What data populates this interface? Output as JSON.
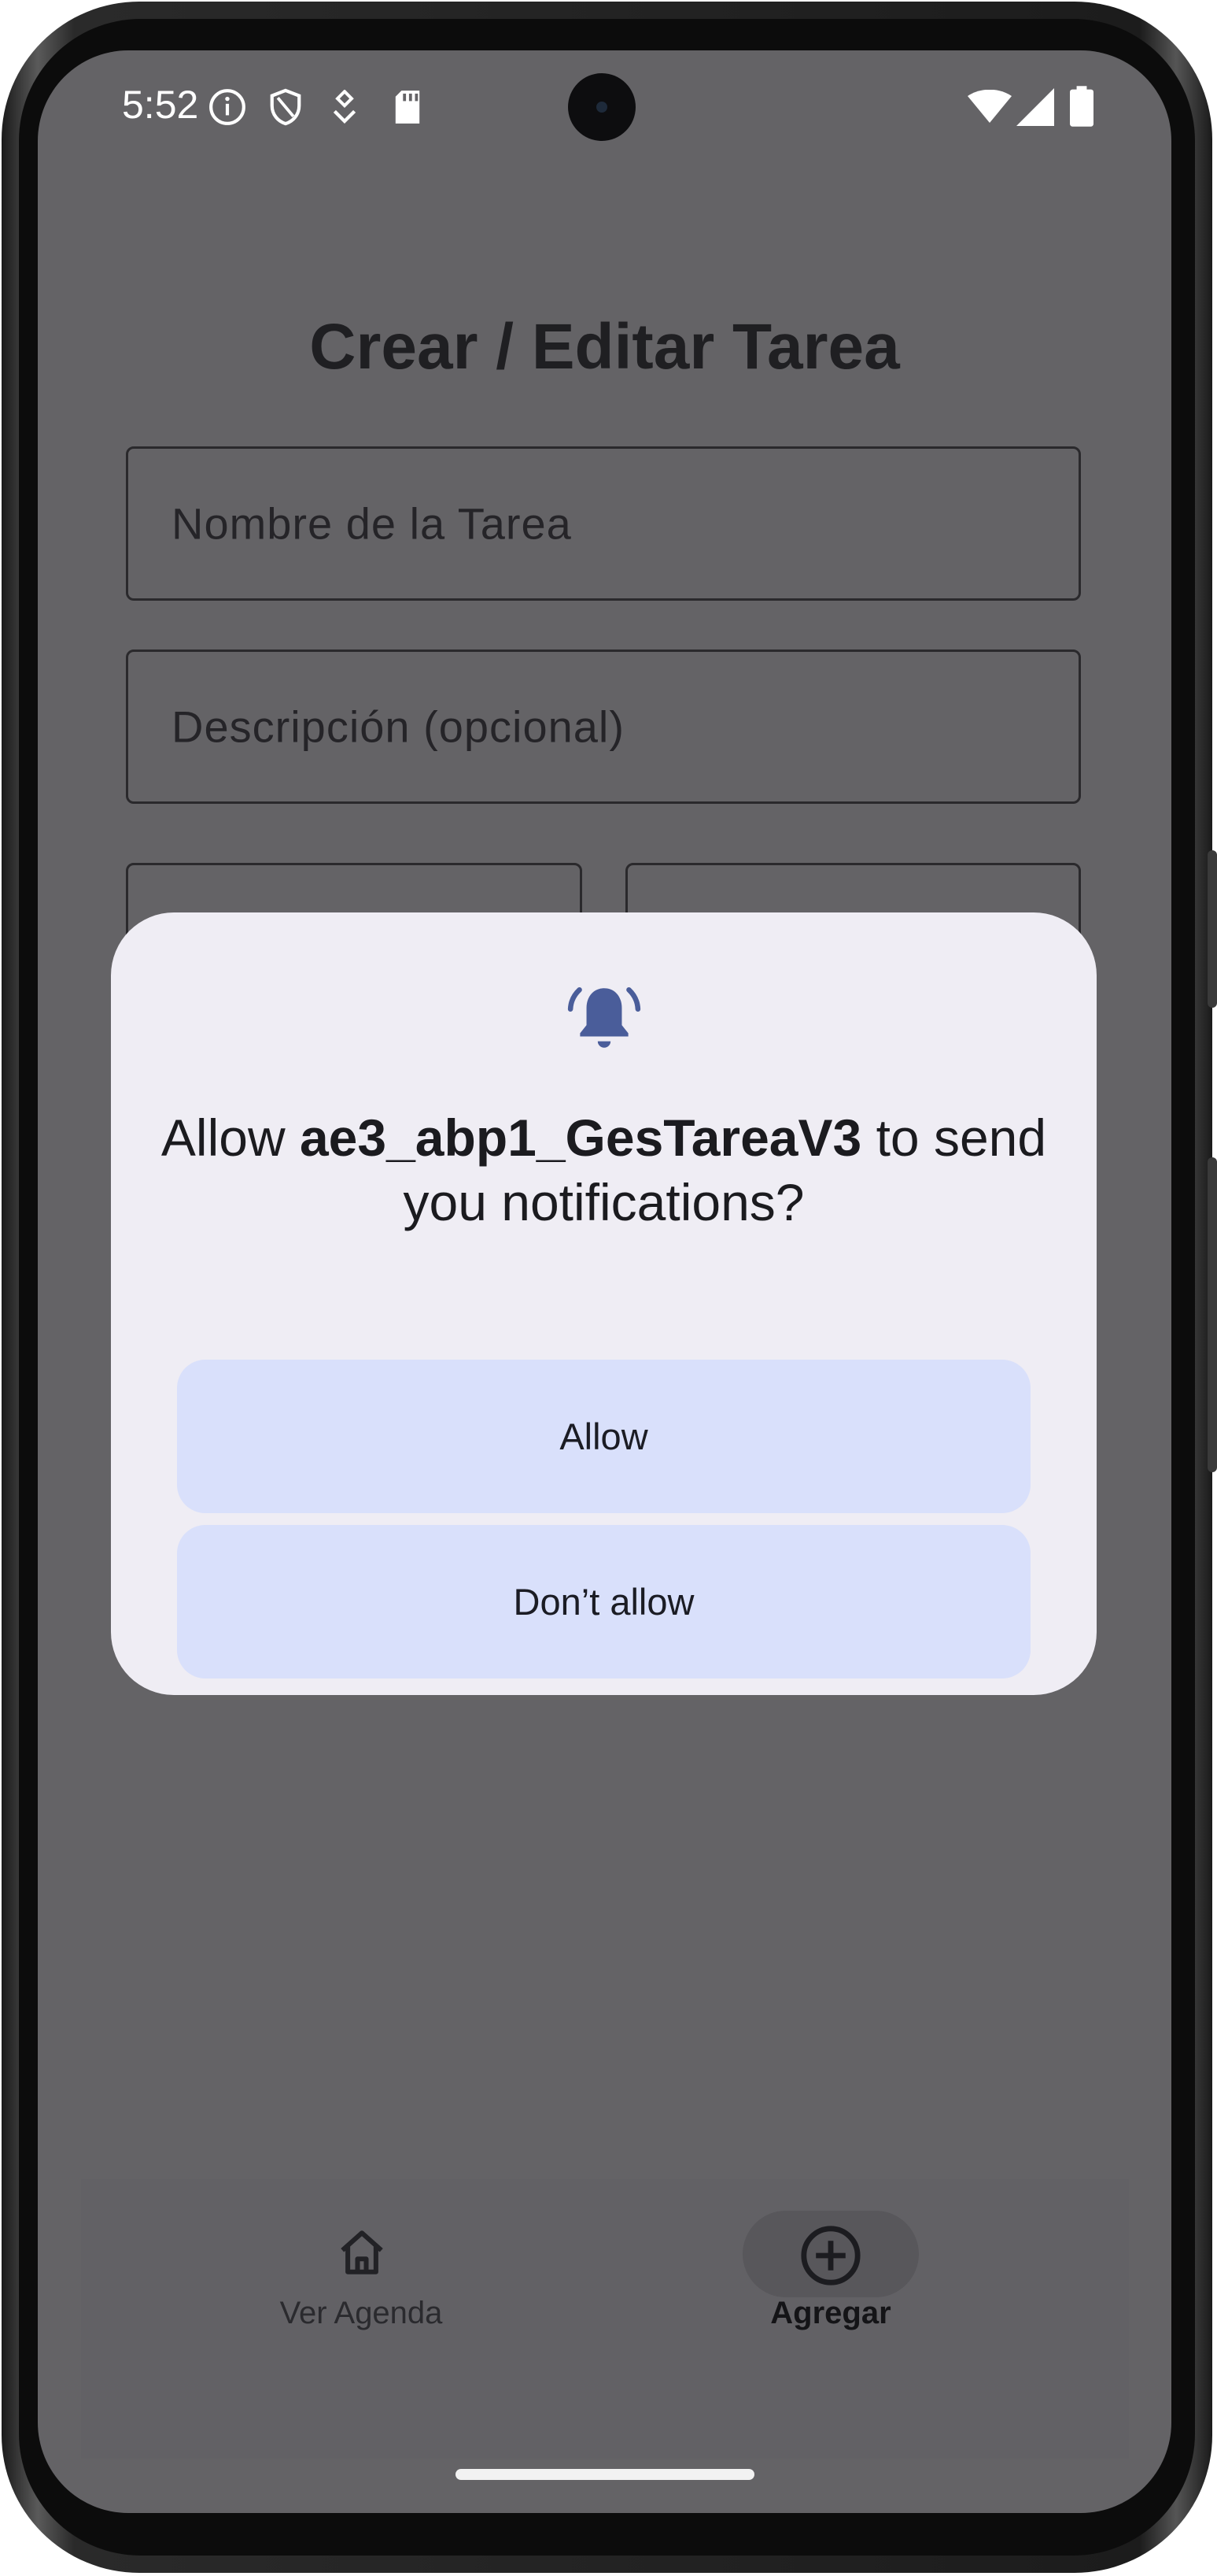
{
  "status_bar": {
    "time": "5:52",
    "left_icons": [
      "info-icon",
      "shield-icon",
      "location-icon",
      "sd-card-icon"
    ],
    "right_icons": [
      "wifi-icon",
      "signal-icon",
      "battery-icon"
    ]
  },
  "app": {
    "title": "Crear / Editar Tarea",
    "fields": {
      "name_placeholder": "Nombre de la Tarea",
      "description_placeholder": "Descripción (opcional)"
    }
  },
  "bottom_nav": {
    "items": [
      {
        "label": "Ver Agenda",
        "icon": "home-icon",
        "selected": false
      },
      {
        "label": "Agregar",
        "icon": "add-circle-icon",
        "selected": true
      }
    ]
  },
  "dialog": {
    "icon": "notification-bell-icon",
    "title_prefix": "Allow ",
    "app_name": "ae3_abp1_GesTareaV3",
    "title_suffix": " to send you notifications?",
    "allow_label": "Allow",
    "deny_label": "Don’t allow"
  },
  "colors": {
    "scrim": "#646366",
    "dialog_bg": "#efedf4",
    "button_bg": "#d9e0fb",
    "bell": "#4a5d9a"
  }
}
